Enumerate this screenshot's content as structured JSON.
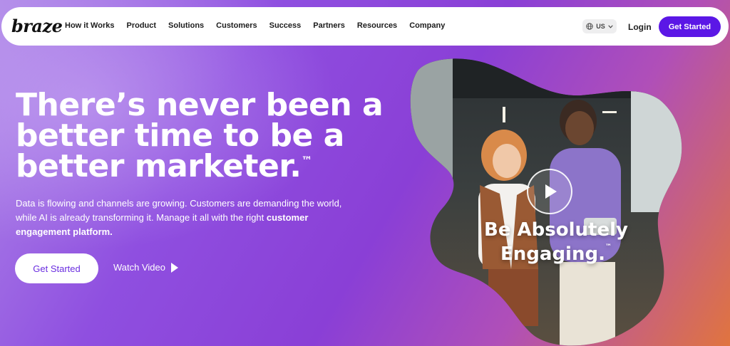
{
  "brand": {
    "logo_text": "braze"
  },
  "nav": {
    "items": [
      "How it Works",
      "Product",
      "Solutions",
      "Customers",
      "Success",
      "Partners",
      "Resources",
      "Company"
    ],
    "region": {
      "label": "US",
      "icon": "globe-icon",
      "chevron": "chevron-down-icon"
    },
    "login": "Login",
    "cta": "Get Started"
  },
  "hero": {
    "headline_line1": "There’s never been a",
    "headline_line2": "better time to be a",
    "headline_line3": "better marketer.",
    "headline_tm": "™",
    "subtext": "Data is flowing and channels are growing. Customers are demanding the world, while AI is already transforming it. Manage it all with the right ",
    "subtext_bold": "customer engagement platform.",
    "primary_cta": "Get Started",
    "secondary_cta": "Watch Video"
  },
  "video": {
    "overlay_line1": "Be Absolutely",
    "overlay_line2": "Engaging.",
    "overlay_tm": "™",
    "play_icon": "play-icon"
  },
  "colors": {
    "accent": "#5b17e6",
    "cta_text": "#6b2ee0",
    "background_start": "#b08ae8",
    "background_mid": "#8a3fd6",
    "background_end": "#e0743f"
  }
}
